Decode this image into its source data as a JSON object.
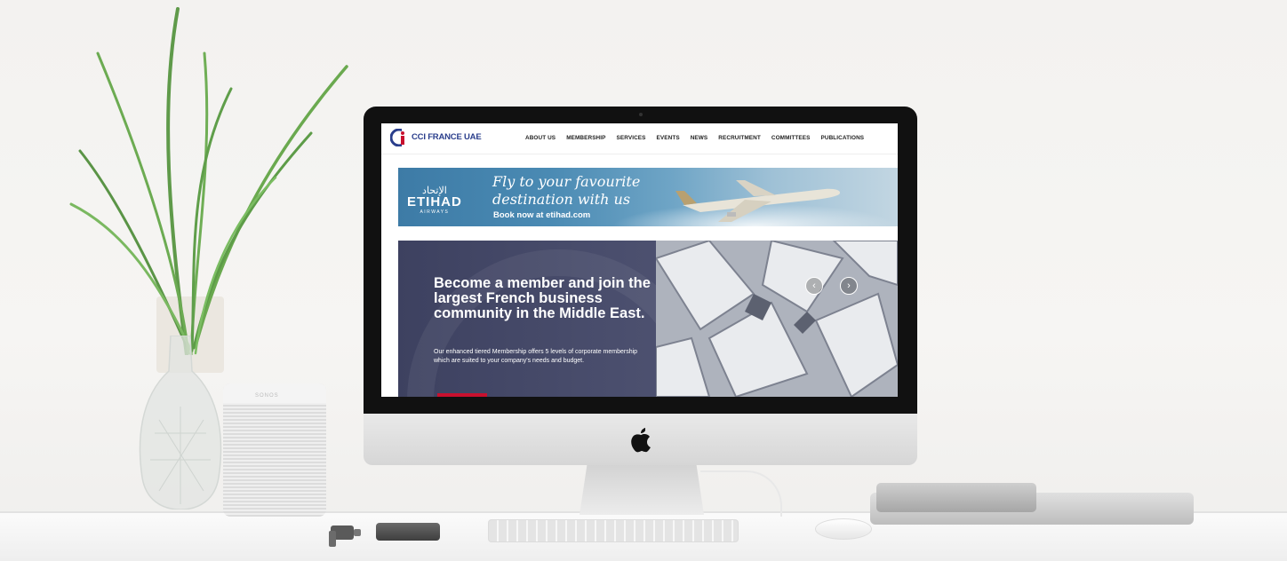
{
  "brand": {
    "logo_text": "CCI FRANCE UAE",
    "accent": "#2a3e8c"
  },
  "nav": {
    "items": [
      "ABOUT US",
      "MEMBERSHIP",
      "SERVICES",
      "EVENTS",
      "NEWS",
      "RECRUITMENT",
      "COMMITTEES",
      "PUBLICATIONS"
    ]
  },
  "ad": {
    "brand_ar": "الإتحاد",
    "brand_en": "ETIHAD",
    "brand_sub": "AIRWAYS",
    "headline_1": "Fly to your favourite",
    "headline_2": "destination with us",
    "cta": "Book now at etihad.com"
  },
  "hero": {
    "title": "Become a member and join the largest French business community in the Middle East.",
    "text": "Our enhanced tiered Membership offers 5 levels of corporate membership which are suited to your company's needs and budget.",
    "prev_icon": "chevron-left-icon",
    "next_icon": "chevron-right-icon",
    "prev_glyph": "‹",
    "next_glyph": "›",
    "button_color": "#c8102e"
  },
  "speaker": {
    "label": "SONOS"
  }
}
